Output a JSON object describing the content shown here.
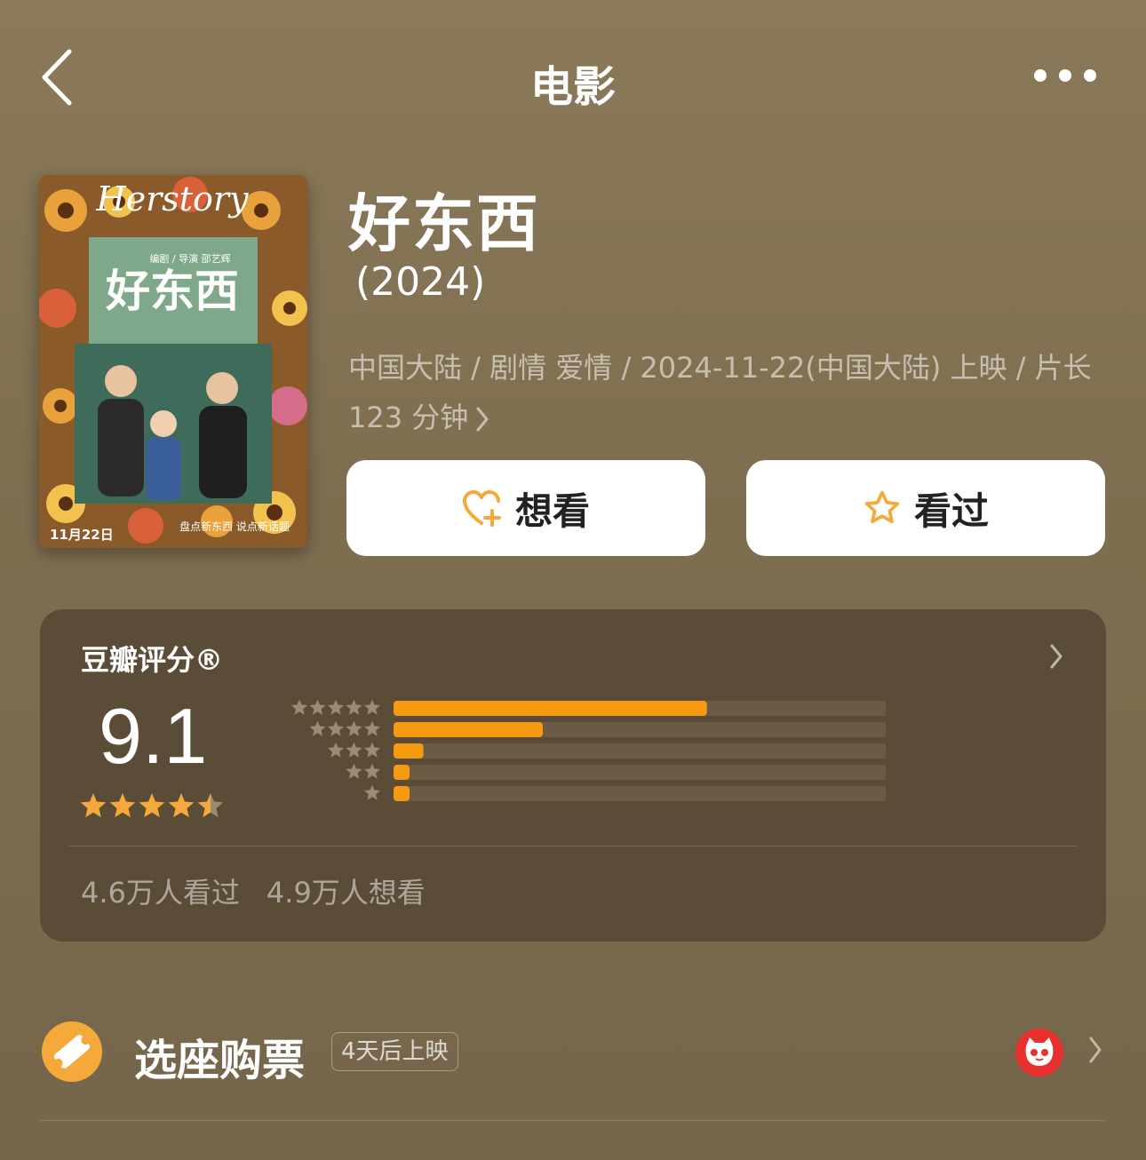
{
  "nav": {
    "title": "电影",
    "back_icon": "chevron-left-icon",
    "more_icon": "more-dots-icon"
  },
  "movie": {
    "title": "好东西",
    "year": "(2024)",
    "meta": "中国大陆 / 剧情 爱情 / 2024-11-22(中国大陆) 上映 / 片长 123 分钟",
    "poster": {
      "script_title": "Herstory",
      "title": "好东西",
      "credit": "编剧 / 导演 邵艺辉",
      "date": "11月22日",
      "tagline": "盘点新东西 说点新话题"
    }
  },
  "actions": {
    "want_label": "想看",
    "seen_label": "看过",
    "accent": "#f4a93a"
  },
  "rating": {
    "title": "豆瓣评分®",
    "score": "9.1",
    "stars": 4.5,
    "distribution": [
      {
        "stars": 5,
        "fraction": 0.63
      },
      {
        "stars": 4,
        "fraction": 0.3
      },
      {
        "stars": 3,
        "fraction": 0.06
      },
      {
        "stars": 2,
        "fraction": 0.03
      },
      {
        "stars": 1,
        "fraction": 0.03
      }
    ],
    "seen_count": "4.6万人看过",
    "want_count": "4.9万人想看"
  },
  "ticket": {
    "label": "选座购票",
    "badge": "4天后上映",
    "icon": "ticket-icon",
    "provider_icon": "maoyan-cat-icon"
  }
}
